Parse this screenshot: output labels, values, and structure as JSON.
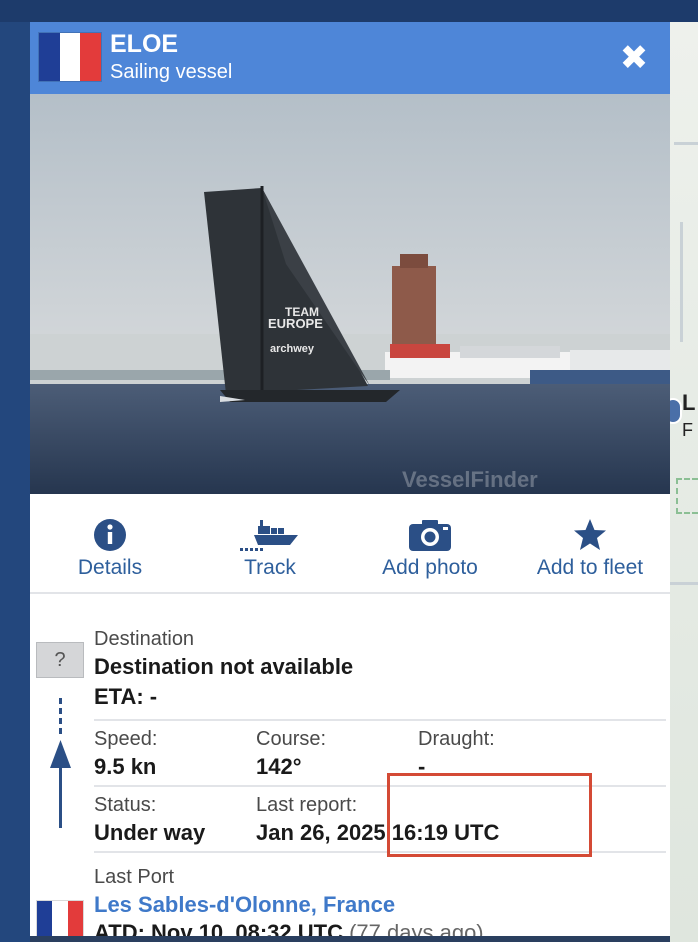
{
  "header": {
    "vessel_name": "ELOE",
    "vessel_type": "Sailing vessel",
    "close_label": "✖",
    "flag_colors": [
      "#1f3e96",
      "#ffffff",
      "#e33b3b"
    ]
  },
  "photo": {
    "sail_text_1": "TEAM",
    "sail_text_2": "EUROPE",
    "sail_text_3": "archwey",
    "watermark": "VesselFinder"
  },
  "actions": [
    {
      "label": "Details",
      "icon": "info-icon"
    },
    {
      "label": "Track",
      "icon": "ship-track-icon"
    },
    {
      "label": "Add photo",
      "icon": "camera-icon"
    },
    {
      "label": "Add to fleet",
      "icon": "star-icon"
    }
  ],
  "voyage": {
    "unknown_badge": "?",
    "destination_label": "Destination",
    "destination_value": "Destination not available",
    "eta": "ETA: -",
    "speed_label": "Speed:",
    "speed_value": "9.5 kn",
    "course_label": "Course:",
    "course_value": "142°",
    "draught_label": "Draught:",
    "draught_value": "-",
    "status_label": "Status:",
    "status_value": "Under way",
    "last_report_label": "Last report:",
    "last_report_value": "Jan 26, 2025 16:19 UTC",
    "last_port_label": "Last Port",
    "last_port_value": "Les Sables-d'Olonne, France",
    "atd_value": "ATD: Nov 10, 08:32 UTC",
    "atd_ago": "(77 days ago)"
  },
  "map": {
    "label_letter": "L",
    "label_letter_2": "F"
  },
  "colors": {
    "header_blue": "#4e86d8",
    "link_blue": "#3f79c9",
    "highlight_red": "#d44a35",
    "navy": "#2b4f86"
  }
}
